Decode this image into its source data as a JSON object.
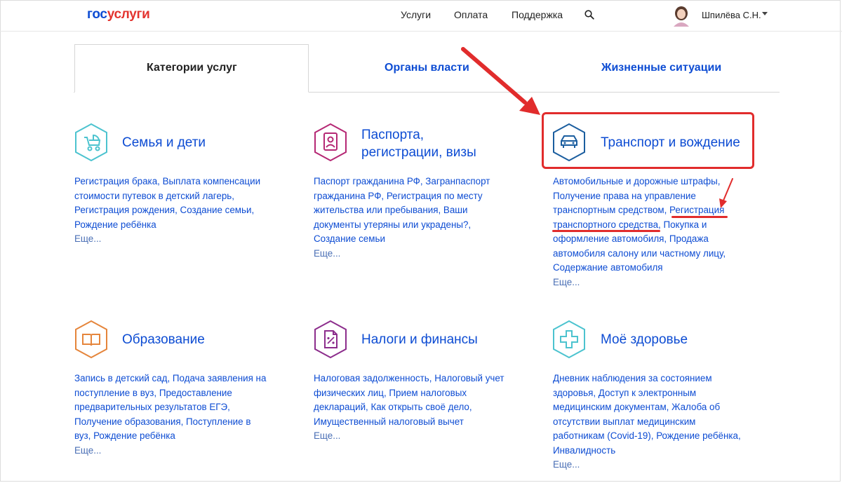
{
  "header": {
    "logo_part1": "гос",
    "logo_part2": "услуги",
    "nav": [
      "Услуги",
      "Оплата",
      "Поддержка"
    ],
    "username": "Шпилёва С.Н."
  },
  "tabs": [
    "Категории услуг",
    "Органы власти",
    "Жизненные ситуации"
  ],
  "categories": [
    {
      "title": "Семья и дети",
      "icon": "stroller-icon",
      "color": "#4cc3cf",
      "links": [
        "Регистрация брака",
        "Выплата компенсации стоимости путевок в детский лагерь",
        "Регистрация рождения",
        "Создание семьи",
        "Рождение ребёнка"
      ],
      "more": "Еще..."
    },
    {
      "title_line1": "Паспорта,",
      "title_line2": "регистрации, визы",
      "icon": "passport-icon",
      "color": "#b52874",
      "links": [
        "Паспорт гражданина РФ",
        "Загранпаспорт гражданина РФ",
        "Регистрация по месту жительства или пребывания",
        "Ваши документы утеряны или украдены?",
        "Создание семьи"
      ],
      "more": "Еще..."
    },
    {
      "title": "Транспорт и вождение",
      "icon": "car-icon",
      "color": "#1b5e9f",
      "links": [
        "Автомобильные и дорожные штрафы",
        "Получение права на управление транспортным средством",
        "Регистрация транспортного средства",
        "Покупка и оформление автомобиля",
        "Продажа автомобиля салону или частному лицу",
        "Содержание автомобиля"
      ],
      "more": "Еще..."
    },
    {
      "title": "Образование",
      "icon": "book-icon",
      "color": "#e5853b",
      "links": [
        "Запись в детский сад",
        "Подача заявления на поступление в вуз",
        "Предоставление предварительных результатов ЕГЭ",
        "Получение образования",
        "Поступление в вуз",
        "Рождение ребёнка"
      ],
      "more": "Еще..."
    },
    {
      "title": "Налоги и финансы",
      "icon": "tax-document-icon",
      "color": "#8c2d8c",
      "links": [
        "Налоговая задолженность",
        "Налоговый учет физических лиц",
        "Прием налоговых деклараций",
        "Как открыть своё дело",
        "Имущественный налоговый вычет"
      ],
      "more": "Еще..."
    },
    {
      "title": "Моё здоровье",
      "icon": "medical-cross-icon",
      "color": "#4cc3cf",
      "links": [
        "Дневник наблюдения за состоянием здоровья",
        "Доступ к электронным медицинским документам",
        "Жалоба об отсутствии выплат медицинским работникам (Covid-19)",
        "Рождение ребёнка",
        "Инвалидность"
      ],
      "more": "Еще..."
    }
  ],
  "desc_lines": {
    "c0": [
      "Регистрация брака, Выплата компенсации",
      "стоимости путевок в детский лагерь,",
      "Регистрация рождения, Создание семьи,",
      "Рождение ребёнка"
    ],
    "c1": [
      "Паспорт гражданина РФ, Загранпаспорт",
      "гражданина РФ, Регистрация по месту",
      "жительства или пребывания, Ваши",
      "документы утеряны или украдены?,",
      "Создание семьи"
    ],
    "c2": [
      "Автомобильные и дорожные штрафы,",
      "Получение права на управление",
      "транспортным средством, Регистрация",
      "транспортного средства, Покупка и",
      "оформление автомобиля, Продажа",
      "автомобиля салону или частному лицу,",
      "Содержание автомобиля"
    ],
    "c3": [
      "Запись в детский сад, Подача заявления на",
      "поступление в вуз, Предоставление",
      "предварительных результатов ЕГЭ,",
      "Получение образования, Поступление в",
      "вуз, Рождение ребёнка"
    ],
    "c4": [
      "Налоговая задолженность, Налоговый учет",
      "физических лиц, Прием налоговых",
      "деклараций, Как открыть своё дело,",
      "Имущественный налоговый вычет"
    ],
    "c5": [
      "Дневник наблюдения за состоянием",
      "здоровья, Доступ к электронным",
      "медицинским документам, Жалоба об",
      "отсутствии выплат медицинским",
      "работникам (Covid-19), Рождение ребёнка,",
      "Инвалидность"
    ]
  },
  "annotation_color": "#e12c2c"
}
